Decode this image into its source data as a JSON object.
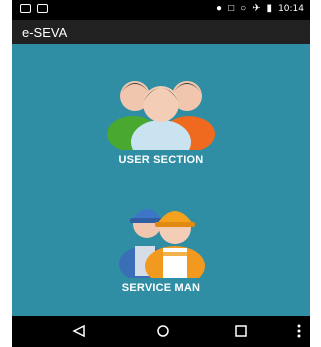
{
  "statusbar": {
    "time": "10:14"
  },
  "appbar": {
    "title": "e-SEVA"
  },
  "tiles": [
    {
      "label": "USER SECTION"
    },
    {
      "label": "SERVICE MAN"
    }
  ],
  "colors": {
    "content_bg": "#2f8ea3",
    "appbar_bg": "#212121",
    "status_bg": "#000000"
  },
  "icons": {
    "user_section": "users-group-icon",
    "service_man": "workers-icon"
  }
}
